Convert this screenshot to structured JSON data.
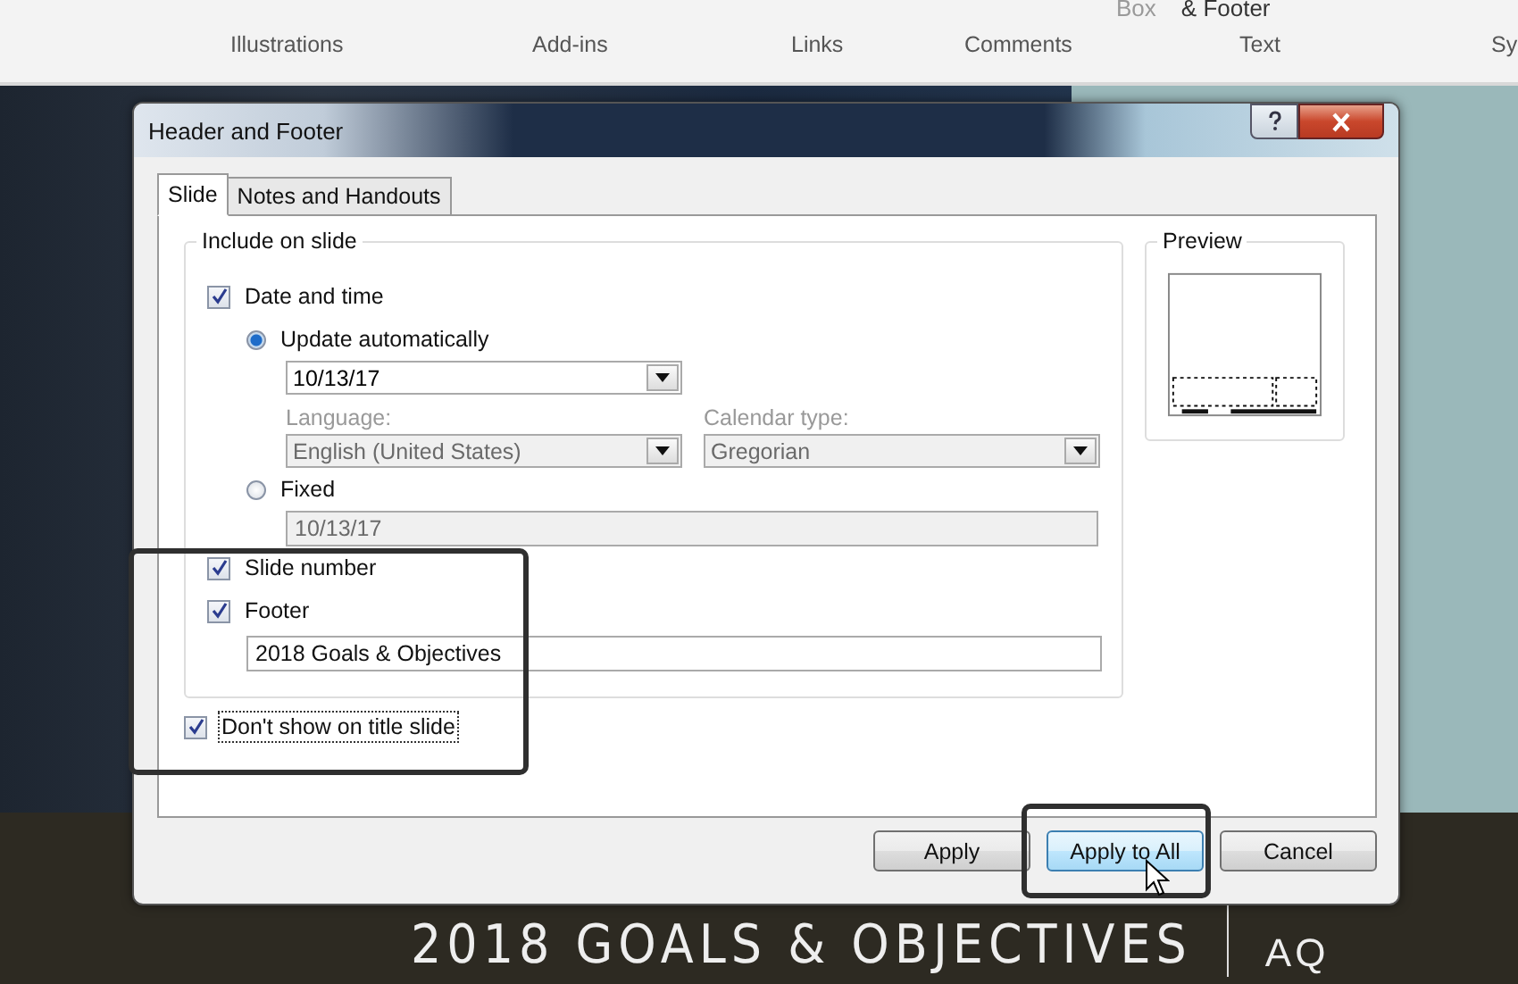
{
  "ribbon": {
    "top_labels": [
      "Box",
      "& Footer"
    ],
    "groups": [
      {
        "label": "Illustrations"
      },
      {
        "label": "Add-ins"
      },
      {
        "label": "Links"
      },
      {
        "label": "Comments"
      },
      {
        "label": "Text"
      },
      {
        "label": "Sy"
      }
    ]
  },
  "slide": {
    "title": "2018 GOALS & OBJECTIVES",
    "side_text": "AQ"
  },
  "dialog": {
    "title": "Header and Footer",
    "tabs": [
      {
        "label": "Slide",
        "selected": true
      },
      {
        "label": "Notes and Handouts",
        "selected": false
      }
    ],
    "include": {
      "legend": "Include on slide",
      "date_time": {
        "label": "Date and time",
        "checked": true
      },
      "update_automatically": {
        "label": "Update automatically",
        "selected": true
      },
      "date_select": {
        "value": "10/13/17"
      },
      "language": {
        "label": "Language:",
        "value": "English (United States)"
      },
      "calendar": {
        "label": "Calendar type:",
        "value": "Gregorian"
      },
      "fixed": {
        "label": "Fixed",
        "selected": false
      },
      "fixed_field": {
        "value": "10/13/17"
      },
      "slide_number": {
        "label": "Slide number",
        "checked": true
      },
      "footer": {
        "label": "Footer",
        "checked": true
      },
      "footer_field": {
        "value": "2018 Goals & Objectives"
      }
    },
    "dont_show": {
      "label": "Don't show on title slide",
      "checked": true
    },
    "preview": {
      "legend": "Preview"
    },
    "buttons": [
      {
        "label": "Apply",
        "hovered": false
      },
      {
        "label": "Apply to All",
        "hovered": true
      },
      {
        "label": "Cancel",
        "hovered": false
      }
    ]
  }
}
